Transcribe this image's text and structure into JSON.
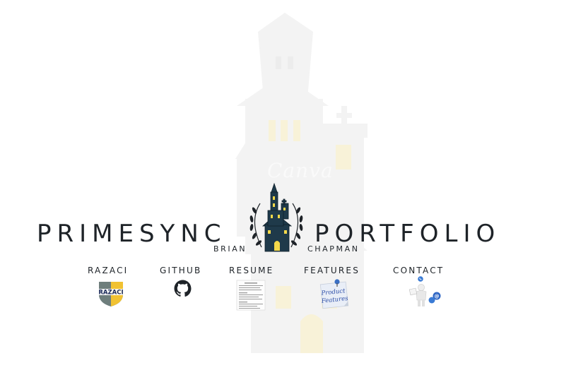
{
  "brand": {
    "left": "PRIMESYNC",
    "right": "PORTFOLIO",
    "first_name": "BRIAN",
    "last_name": "CHAPMAN"
  },
  "watermark": "Canva",
  "nav": [
    {
      "label": "RAZACI",
      "icon": "razaci-shield-icon"
    },
    {
      "label": "GITHUB",
      "icon": "github-icon"
    },
    {
      "label": "RESUME",
      "icon": "resume-document-icon"
    },
    {
      "label": "FEATURES",
      "icon": "product-features-note-icon",
      "icon_text": [
        "Product",
        "Features"
      ]
    },
    {
      "label": "CONTACT",
      "icon": "contact-person-icon"
    }
  ],
  "razaci_badge_text": "RAZACI",
  "colors": {
    "text": "#1e2328",
    "house": "#1f3a4a",
    "window": "#f5d94a",
    "background_house": "#f2f2f2"
  }
}
